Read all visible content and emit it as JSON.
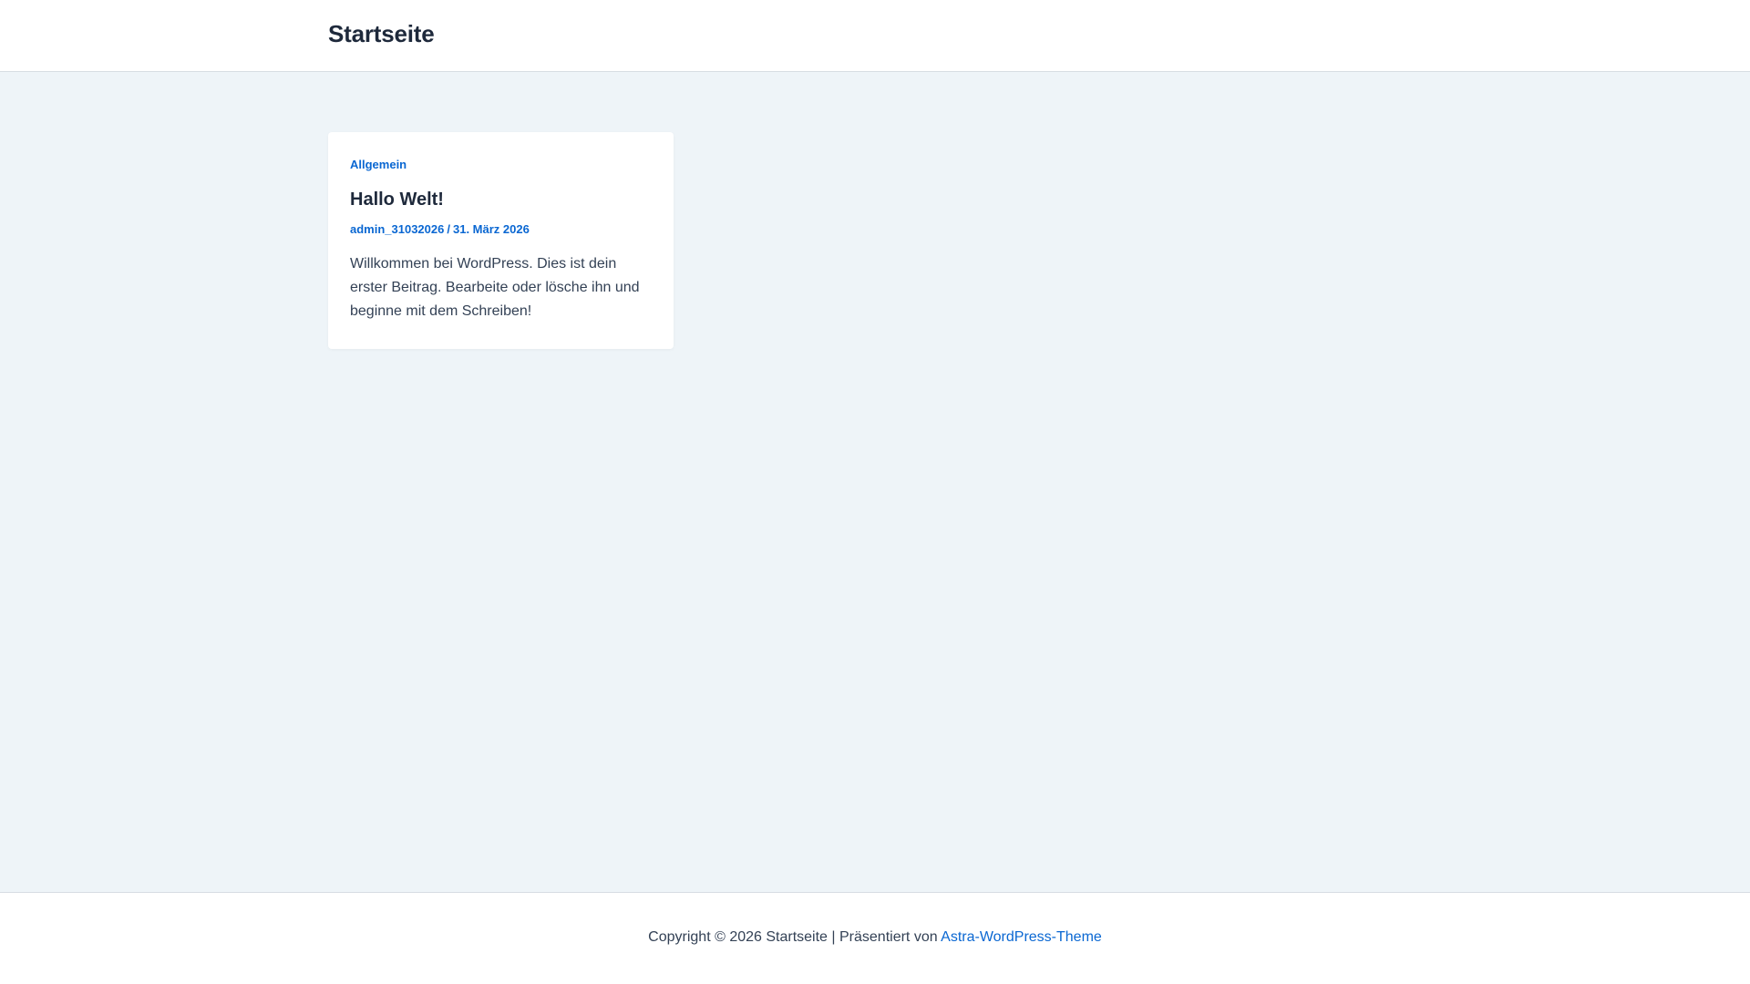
{
  "header": {
    "site_title": "Startseite"
  },
  "post": {
    "category": "Allgemein",
    "title": "Hallo Welt!",
    "author": "admin_31032026",
    "meta_separator": "/",
    "date": "31. März 2026",
    "excerpt": "Willkommen bei WordPress. Dies ist dein erster Beitrag. Bearbeite oder lösche ihn und beginne mit dem Schreiben!"
  },
  "footer": {
    "copyright": "Copyright © 2026 Startseite | Präsentiert von",
    "theme_link": "Astra-WordPress-Theme"
  },
  "colors": {
    "accent": "#0a67d2",
    "page_background": "#eef4f8",
    "heading": "#1e293b",
    "body_text": "#334155"
  }
}
